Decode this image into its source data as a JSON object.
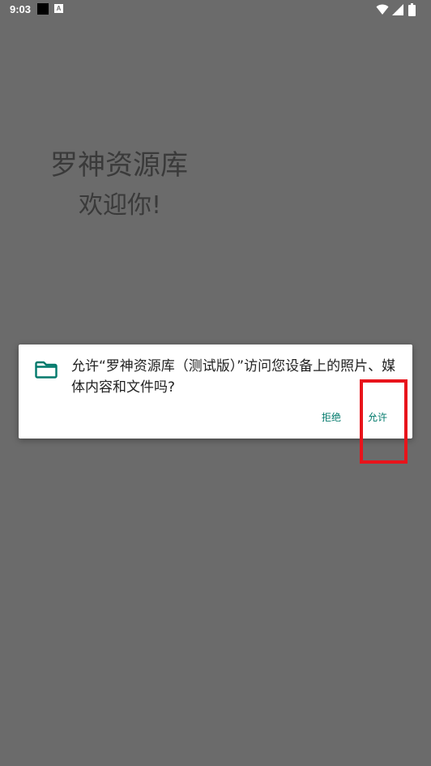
{
  "status_bar": {
    "time": "9:03",
    "notif_a_label": "A",
    "icons": [
      "wifi-icon",
      "cellular-icon",
      "battery-icon"
    ]
  },
  "app": {
    "title": "罗神资源库",
    "welcome": "欢迎你!"
  },
  "dialog": {
    "message": "允许“罗神资源库（测试版）”访问您设备上的照片、媒体内容和文件吗?",
    "deny_label": "拒绝",
    "allow_label": "允许",
    "icon": "folder-icon"
  },
  "colors": {
    "scrim": "#6b6b6b",
    "dialog_bg": "#ffffff",
    "accent": "#00796b",
    "highlight": "#e8141b"
  }
}
